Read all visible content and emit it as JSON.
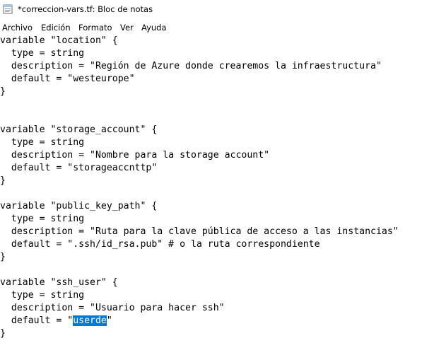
{
  "window": {
    "title": "*correccion-vars.tf: Bloc de notas",
    "icon": "notepad-icon"
  },
  "menu": {
    "items": [
      "Archivo",
      "Edición",
      "Formato",
      "Ver",
      "Ayuda"
    ]
  },
  "editor": {
    "lines": [
      "variable \"location\" {",
      "  type = string",
      "  description = \"Región de Azure donde crearemos la infraestructura\"",
      "  default = \"westeurope\"",
      "}",
      "",
      "variable \"storage_account\" {",
      "  type = string",
      "  description = \"Nombre para la storage account\"",
      "  default = \"storageaccnttp\"",
      "}",
      "",
      "variable \"public_key_path\" {",
      "  type = string",
      "  description = \"Ruta para la clave pública de acceso a las instancias\"",
      "  default = \".ssh/id_rsa.pub\" # o la ruta correspondiente",
      "}",
      "",
      "variable \"ssh_user\" {",
      "  type = string",
      "  description = \"Usuario para hacer ssh\"",
      "  default = \"userde\"",
      "}"
    ],
    "selection": {
      "line": 21,
      "before": "  default = \"",
      "selected": "userde",
      "after": "\""
    },
    "selection_color": "#0078d7"
  }
}
